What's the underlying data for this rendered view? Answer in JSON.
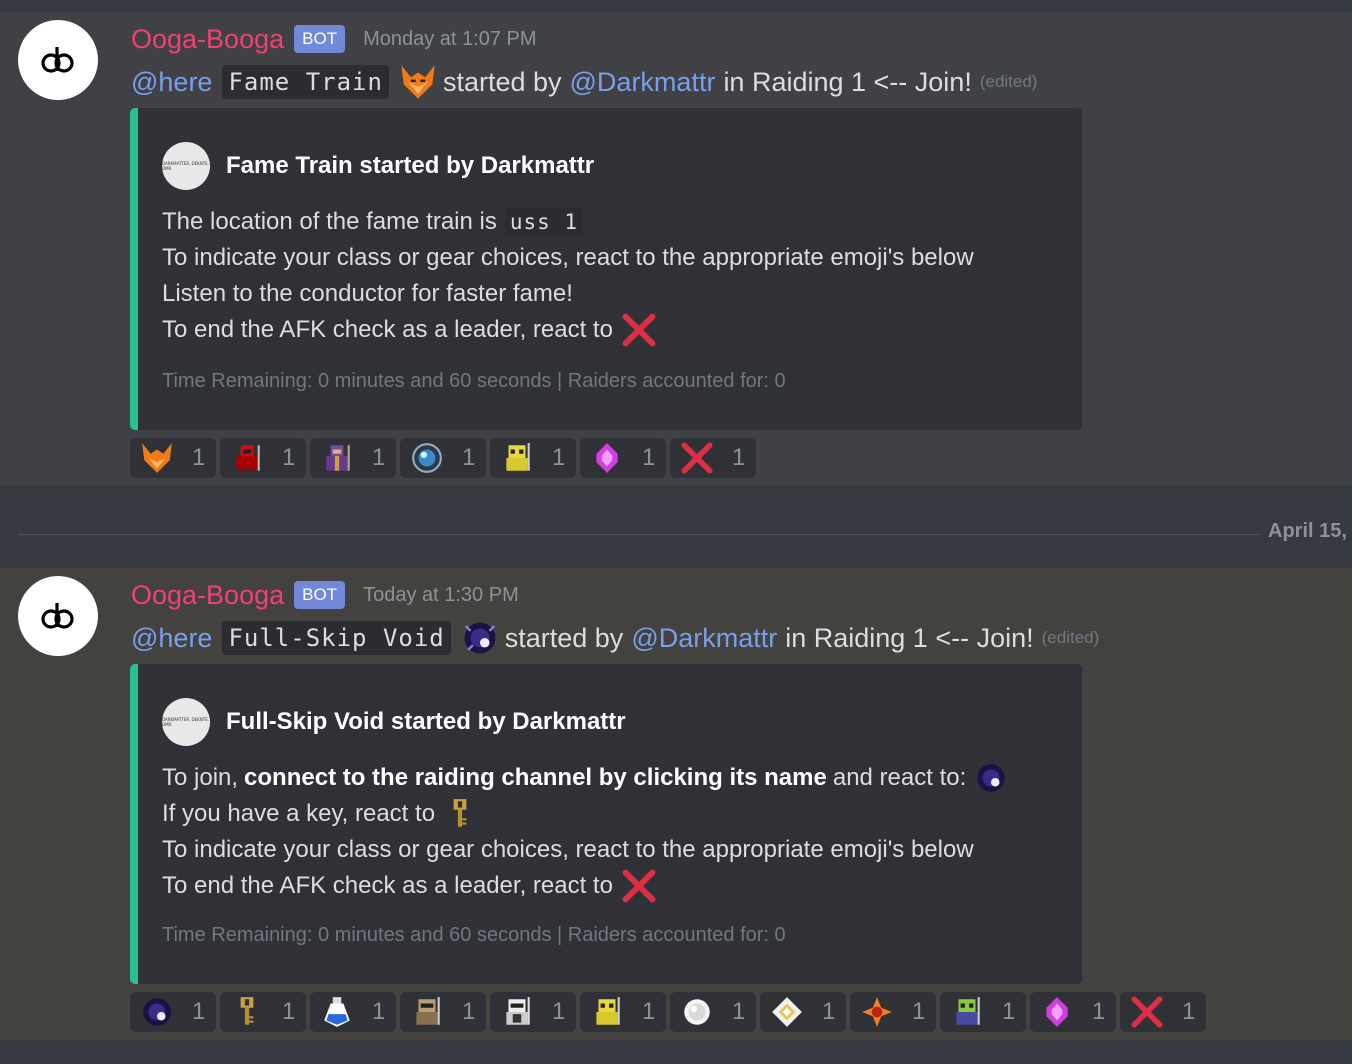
{
  "messages": [
    {
      "username": "Ooga-Booga",
      "badge": "BOT",
      "timestamp": "Monday at 1:07 PM",
      "mention_here": "@here",
      "code_label": "Fame Train",
      "started_by": "started by",
      "user_mention": "@Darkmattr",
      "in_text": "in Raiding 1 <-- Join!",
      "edited": "(edited)",
      "embed": {
        "author_icon_text": "DARKMATTER. DEKNTE. DMR.",
        "author": "Fame Train started by Darkmattr",
        "lines": {
          "l1_text": "The location of the fame train is",
          "l1_code": "uss 1",
          "l2": "To indicate your class or gear choices, react to the appropriate emoji's below",
          "l3": "Listen to the conductor for faster fame!",
          "l4": "To end the AFK check as a leader, react to"
        },
        "footer": "Time Remaining: 0 minutes and 60 seconds | Raiders accounted for: 0"
      },
      "reactions": [
        {
          "icon": "fox-mask-icon",
          "count": "1"
        },
        {
          "icon": "red-warrior-icon",
          "count": "1"
        },
        {
          "icon": "purple-mystic-icon",
          "count": "1"
        },
        {
          "icon": "blue-orb-icon",
          "count": "1"
        },
        {
          "icon": "yellow-knight-icon",
          "count": "1"
        },
        {
          "icon": "pink-gem-icon",
          "count": "1"
        },
        {
          "icon": "red-x-icon",
          "count": "1"
        }
      ]
    },
    {
      "username": "Ooga-Booga",
      "badge": "BOT",
      "timestamp": "Today at 1:30 PM",
      "mention_here": "@here",
      "code_label": "Full-Skip Void",
      "started_by": "started by",
      "user_mention": "@Darkmattr",
      "in_text": "in Raiding 1 <-- Join!",
      "edited": "(edited)",
      "embed": {
        "author_icon_text": "DARKMATTER. DEKNTE. DMR.",
        "author": "Full-Skip Void started by Darkmattr",
        "lines": {
          "l1_pre": "To join,",
          "l1_bold": "connect to the raiding channel by clicking its name",
          "l1_post": "and react to:",
          "l2": "If you have a key, react to",
          "l3": "To indicate your class or gear choices, react to the appropriate emoji's below",
          "l4": "To end the AFK check as a leader, react to"
        },
        "footer": "Time Remaining: 0 minutes and 60 seconds | Raiders accounted for: 0"
      },
      "reactions": [
        {
          "icon": "void-portal-icon",
          "count": "1"
        },
        {
          "icon": "key-icon",
          "count": "1"
        },
        {
          "icon": "blue-potion-icon",
          "count": "1"
        },
        {
          "icon": "tan-knight-icon",
          "count": "1"
        },
        {
          "icon": "white-warrior-icon",
          "count": "1"
        },
        {
          "icon": "yellow-knight-icon",
          "count": "1"
        },
        {
          "icon": "white-orb-icon",
          "count": "1"
        },
        {
          "icon": "white-diamond-icon",
          "count": "1"
        },
        {
          "icon": "orange-star-icon",
          "count": "1"
        },
        {
          "icon": "green-mystic-icon",
          "count": "1"
        },
        {
          "icon": "pink-gem-icon",
          "count": "1"
        },
        {
          "icon": "red-x-icon",
          "count": "1"
        }
      ]
    }
  ],
  "divider_label": "April 15,",
  "colors": {
    "username": "#f04172",
    "mention": "#7a9eea",
    "embed_border": "#27c092",
    "bot_badge": "#7289da"
  }
}
